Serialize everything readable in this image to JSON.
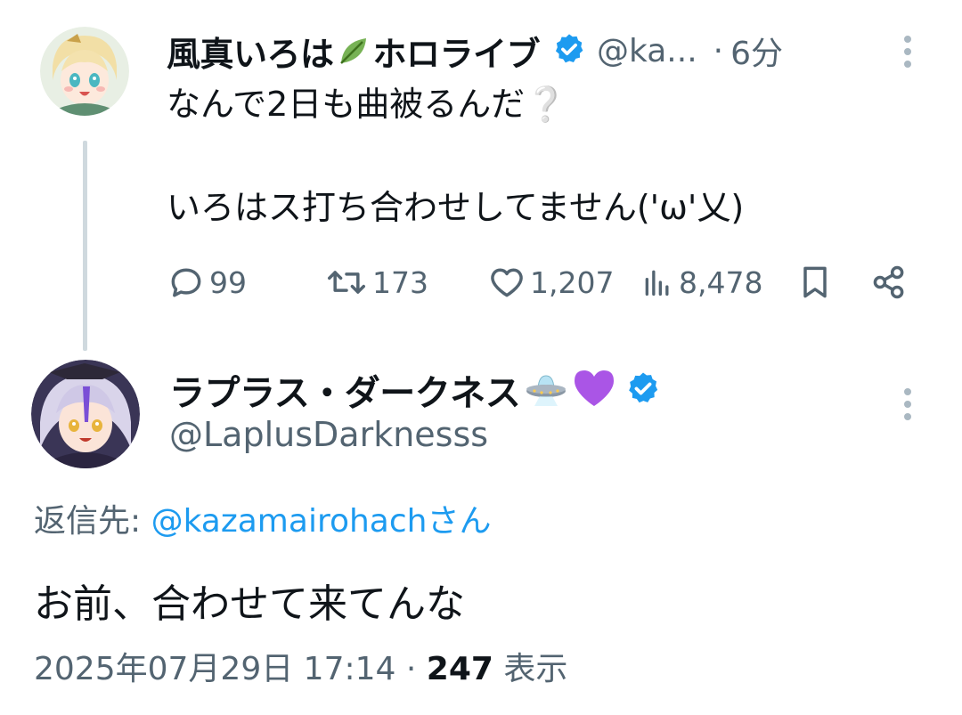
{
  "parent_tweet": {
    "display_name": "風真いろは",
    "display_name_suffix": "ホロライブ",
    "handle": "@ka...",
    "separator": "·",
    "time": "6分",
    "text_line1": "なんで2日も曲被るんだ",
    "text_line1_emoji": "❔",
    "text_line2": "いろはス打ち合わせしてません('ω'乂)",
    "actions": {
      "replies": "99",
      "retweets": "173",
      "likes": "1,207",
      "views": "8,478"
    },
    "icons": {
      "leaf": "leaf-emoji-icon",
      "verified": "verified-badge-icon"
    }
  },
  "reply_tweet": {
    "display_name": "ラプラス・ダークネス",
    "name_emojis": [
      "ufo-emoji-icon",
      "purple-heart-emoji-icon"
    ],
    "handle": "@LaplusDarknesss",
    "reply_to_label": "返信先: ",
    "reply_to_handle": "@kazamairohachさん",
    "text": "お前、合わせて来てんな",
    "timestamp": "2025年07月29日 17:14",
    "meta_separator": " · ",
    "view_count": "247",
    "view_label": " 表示"
  },
  "colors": {
    "text": "#0f1419",
    "secondary": "#536471",
    "link": "#1d9bf0",
    "verified": "#1d9bf0",
    "thread_line": "#cfd9de"
  }
}
